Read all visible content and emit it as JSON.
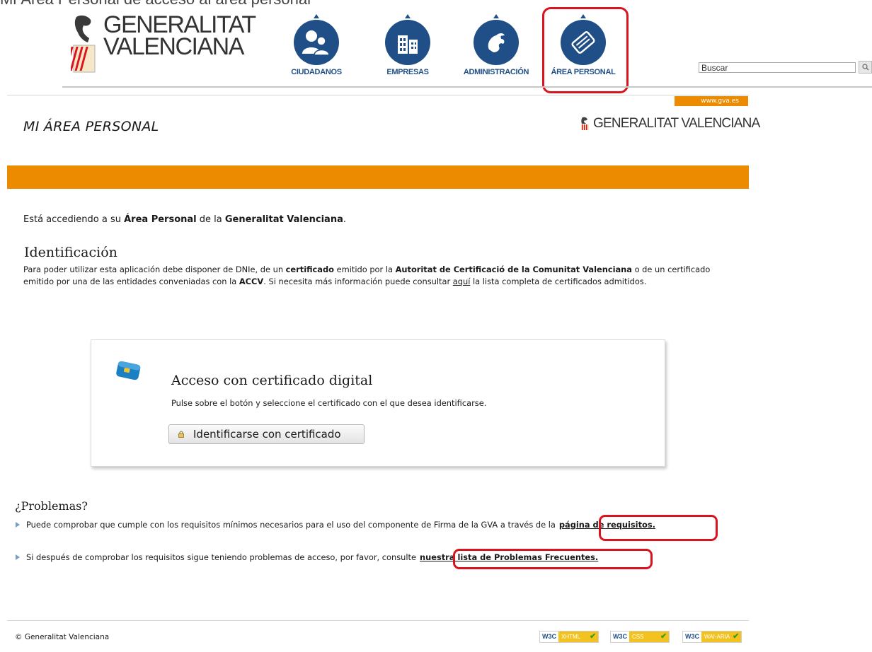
{
  "caption": "Mi Área Personal de acceso al área personal",
  "header": {
    "logo_line1": "GENERALITAT",
    "logo_line2": "VALENCIANA",
    "nav": [
      {
        "label": "CIUDADANOS",
        "icon": "citizens-icon"
      },
      {
        "label": "EMPRESAS",
        "icon": "buildings-icon"
      },
      {
        "label": "ADMINISTRACIÓN",
        "icon": "administration-icon"
      },
      {
        "label": "ÁREA PERSONAL",
        "icon": "personal-area-icon"
      }
    ],
    "search_value": "Buscar",
    "gva_link": "www.gva.es"
  },
  "page": {
    "title": "MI ÁREA PERSONAL",
    "brand_right": "GENERALITAT VALENCIANA",
    "intro": {
      "pre": "Está accediendo a su ",
      "b1": "Área Personal",
      "mid": " de la ",
      "b2": "Generalitat Valenciana",
      "post": "."
    },
    "identification": {
      "heading": "Identificación",
      "p1": "Para poder utilizar esta aplicación debe disponer de DNIe, de un ",
      "b1": "certificado",
      "p2": " emitido por la ",
      "b2": "Autoritat de Certificació de la Comunitat Valenciana",
      "p3": " o de un certificado emitido por una de las entidades conveniadas con la ",
      "b3": "ACCV",
      "p4": ". Si necesita más información puede consultar ",
      "link": "aquí",
      "p5": " la lista completa de certificados admitidos."
    },
    "cert_card": {
      "title": "Acceso con certificado digital",
      "subtitle": "Pulse sobre el botón y seleccione el certificado con el que desea identificarse.",
      "button": "Identificarse con certificado"
    },
    "problems": {
      "heading": "¿Problemas?",
      "item1_text": "Puede comprobar que cumple con los requisitos mínimos necesarios para el uso del componente de Firma de la GVA a través de la",
      "item1_link": "página de requisitos.",
      "item2_text": "Si después de comprobar los requisitos sigue teniendo problemas de acceso, por favor, consulte",
      "item2_link": "nuestra lista de Problemas Frecuentes."
    }
  },
  "footer": {
    "copyright": "© Generalitat Valenciana",
    "badges": [
      {
        "w3c": "W3C",
        "kind": "XHTML"
      },
      {
        "w3c": "W3C",
        "kind": "CSS"
      },
      {
        "w3c": "W3C",
        "kind": "WAI-ARIA"
      }
    ]
  },
  "colors": {
    "accent_orange": "#ed8b00",
    "nav_blue": "#1f4f86",
    "annotation_red": "#d9141f"
  }
}
